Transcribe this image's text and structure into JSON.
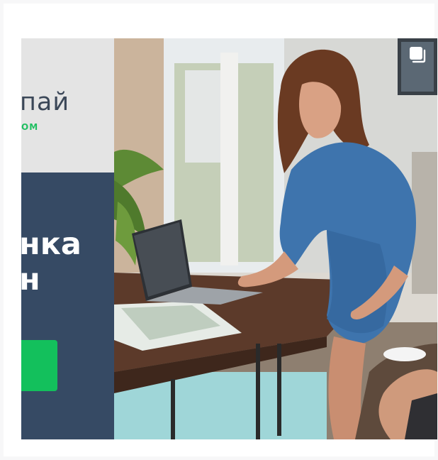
{
  "banner": {
    "brand_name": "пай",
    "brand_sub": "ОМ",
    "headline_line1": "нка",
    "headline_line2": "н",
    "colors": {
      "accent": "#13c05c",
      "panel": "#364a64",
      "text": "#3b4758"
    }
  },
  "icons": {
    "multi_photo": "carousel-icon"
  }
}
